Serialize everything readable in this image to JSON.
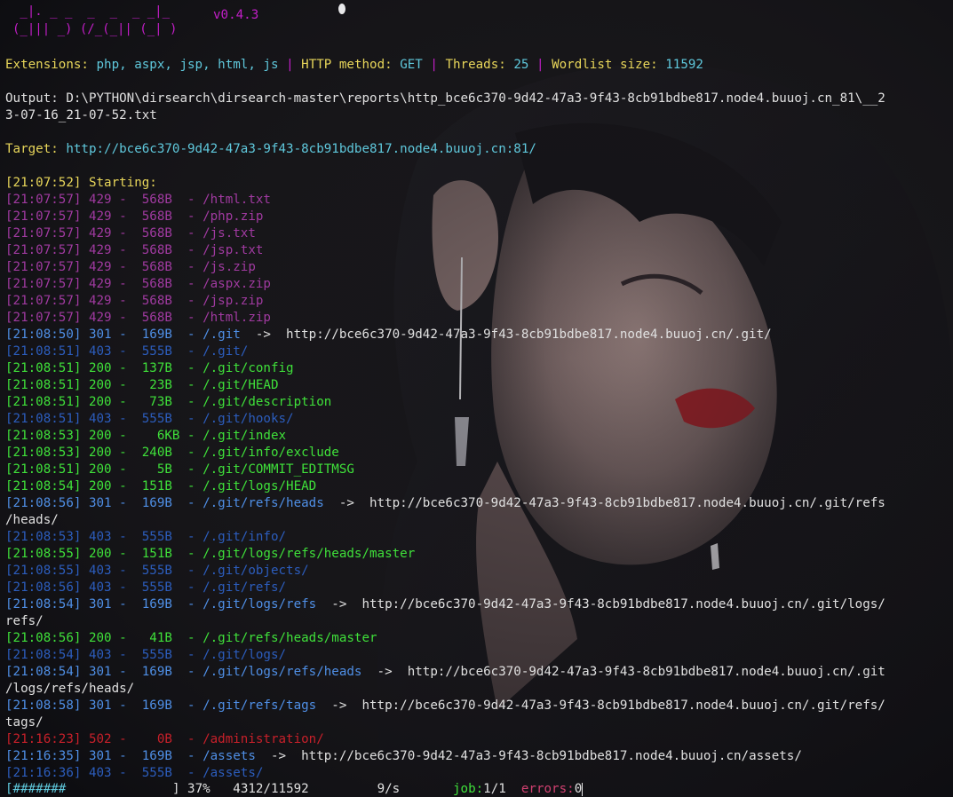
{
  "banner": {
    "art_line1": " _|. _ _  _  _  _ _|_",
    "art_line2": "(_||| _) (/_(_|| (_| )",
    "version": "v0.4.3"
  },
  "config": {
    "extensions_label": "Extensions:",
    "extensions_value": "php, aspx, jsp, html, js",
    "separator": "|",
    "method_label": "HTTP method:",
    "method_value": "GET",
    "threads_label": "Threads:",
    "threads_value": "25",
    "wordlist_label": "Wordlist size:",
    "wordlist_value": "11592"
  },
  "output": {
    "line1": "Output: D:\\PYTHON\\dirsearch\\dirsearch-master\\reports\\http_bce6c370-9d42-47a3-9f43-8cb91bdbe817.node4.buuoj.cn_81\\__2",
    "line2": "3-07-16_21-07-52.txt"
  },
  "target": {
    "label": "Target:",
    "url": "http://bce6c370-9d42-47a3-9f43-8cb91bdbe817.node4.buuoj.cn:81/"
  },
  "start_line": "[21:07:52] Starting:",
  "results": [
    {
      "text": "[21:07:57] 429 -  568B  - /html.txt",
      "color": "purple"
    },
    {
      "text": "[21:07:57] 429 -  568B  - /php.zip",
      "color": "purple"
    },
    {
      "text": "[21:07:57] 429 -  568B  - /js.txt",
      "color": "purple"
    },
    {
      "text": "[21:07:57] 429 -  568B  - /jsp.txt",
      "color": "purple"
    },
    {
      "text": "[21:07:57] 429 -  568B  - /js.zip",
      "color": "purple"
    },
    {
      "text": "[21:07:57] 429 -  568B  - /aspx.zip",
      "color": "purple"
    },
    {
      "text": "[21:07:57] 429 -  568B  - /jsp.zip",
      "color": "purple"
    },
    {
      "text": "[21:07:57] 429 -  568B  - /html.zip",
      "color": "purple"
    },
    {
      "text": "[21:08:50] 301 -  169B  - /.git",
      "color": "blue",
      "redirect": "  ->  http://bce6c370-9d42-47a3-9f43-8cb91bdbe817.node4.buuoj.cn/.git/"
    },
    {
      "text": "[21:08:51] 403 -  555B  - /.git/",
      "color": "dblue"
    },
    {
      "text": "[21:08:51] 200 -  137B  - /.git/config",
      "color": "green"
    },
    {
      "text": "[21:08:51] 200 -   23B  - /.git/HEAD",
      "color": "green"
    },
    {
      "text": "[21:08:51] 200 -   73B  - /.git/description",
      "color": "green"
    },
    {
      "text": "[21:08:51] 403 -  555B  - /.git/hooks/",
      "color": "dblue"
    },
    {
      "text": "[21:08:53] 200 -    6KB - /.git/index",
      "color": "green"
    },
    {
      "text": "[21:08:53] 200 -  240B  - /.git/info/exclude",
      "color": "green"
    },
    {
      "text": "[21:08:51] 200 -    5B  - /.git/COMMIT_EDITMSG",
      "color": "green"
    },
    {
      "text": "[21:08:54] 200 -  151B  - /.git/logs/HEAD",
      "color": "green"
    },
    {
      "text": "[21:08:56] 301 -  169B  - /.git/refs/heads",
      "color": "blue",
      "redirect": "  ->  http://bce6c370-9d42-47a3-9f43-8cb91bdbe817.node4.buuoj.cn/.git/refs",
      "wrap": "/heads/"
    },
    {
      "text": "[21:08:53] 403 -  555B  - /.git/info/",
      "color": "dblue"
    },
    {
      "text": "[21:08:55] 200 -  151B  - /.git/logs/refs/heads/master",
      "color": "green"
    },
    {
      "text": "[21:08:55] 403 -  555B  - /.git/objects/",
      "color": "dblue"
    },
    {
      "text": "[21:08:56] 403 -  555B  - /.git/refs/",
      "color": "dblue"
    },
    {
      "text": "[21:08:54] 301 -  169B  - /.git/logs/refs",
      "color": "blue",
      "redirect": "  ->  http://bce6c370-9d42-47a3-9f43-8cb91bdbe817.node4.buuoj.cn/.git/logs/",
      "wrap": "refs/"
    },
    {
      "text": "[21:08:56] 200 -   41B  - /.git/refs/heads/master",
      "color": "green"
    },
    {
      "text": "[21:08:54] 403 -  555B  - /.git/logs/",
      "color": "dblue"
    },
    {
      "text": "[21:08:54] 301 -  169B  - /.git/logs/refs/heads",
      "color": "blue",
      "redirect": "  ->  http://bce6c370-9d42-47a3-9f43-8cb91bdbe817.node4.buuoj.cn/.git",
      "wrap": "/logs/refs/heads/"
    },
    {
      "text": "[21:08:58] 301 -  169B  - /.git/refs/tags",
      "color": "blue",
      "redirect": "  ->  http://bce6c370-9d42-47a3-9f43-8cb91bdbe817.node4.buuoj.cn/.git/refs/",
      "wrap": "tags/"
    },
    {
      "text": "[21:16:23] 502 -    0B  - /administration/",
      "color": "red"
    },
    {
      "text": "[21:16:35] 301 -  169B  - /assets",
      "color": "blue",
      "redirect": "  ->  http://bce6c370-9d42-47a3-9f43-8cb91bdbe817.node4.buuoj.cn/assets/"
    },
    {
      "text": "[21:16:36] 403 -  555B  - /assets/",
      "color": "dblue"
    }
  ],
  "progress": {
    "bar_open": "[",
    "bar_fill": "#######",
    "bar_close": "]",
    "percent": "37%",
    "count": "4312/11592",
    "rate": "9/s",
    "job_label": "job:",
    "job_value": "1/1",
    "errors_label": "errors:",
    "errors_value": "0",
    "fraction": 0.37
  },
  "colors": {
    "purple": "#a03aa0",
    "blue": "#4f8fe6",
    "dblue": "#2c5dbd",
    "green": "#3fe03a",
    "red": "#c7202a",
    "yellow": "#e8d65a",
    "cyan": "#5fc8dc",
    "magenta": "#c21ec7"
  }
}
